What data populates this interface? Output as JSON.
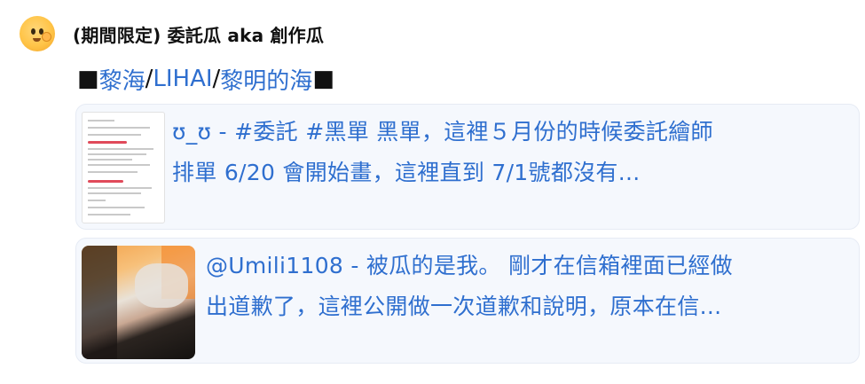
{
  "post": {
    "author_name": "(期間限定) 委託瓜 aka 創作瓜",
    "avatar_icon": "emoji-face-icon",
    "title": {
      "left_square": "■",
      "part1": "黎海",
      "sep1": "/",
      "part2": "LIHAI",
      "sep2": "/",
      "part3": "黎明的海",
      "right_square": "■"
    }
  },
  "cards": [
    {
      "line1": "ʊ_ʊ - #委託 #黑單 黑單，這裡５月份的時候委託繪師",
      "line2": "排單 6/20 會開始畫，這裡直到 7/1號都沒有..."
    },
    {
      "line1": "@Umili1108 - 被瓜的是我。 剛才在信箱裡面已經做",
      "line2": "出道歉了，這裡公開做一次道歉和說明，原本在信..."
    }
  ],
  "colors": {
    "link": "#2f6fcf",
    "card_bg": "#f5f8fd",
    "text": "#111111"
  }
}
